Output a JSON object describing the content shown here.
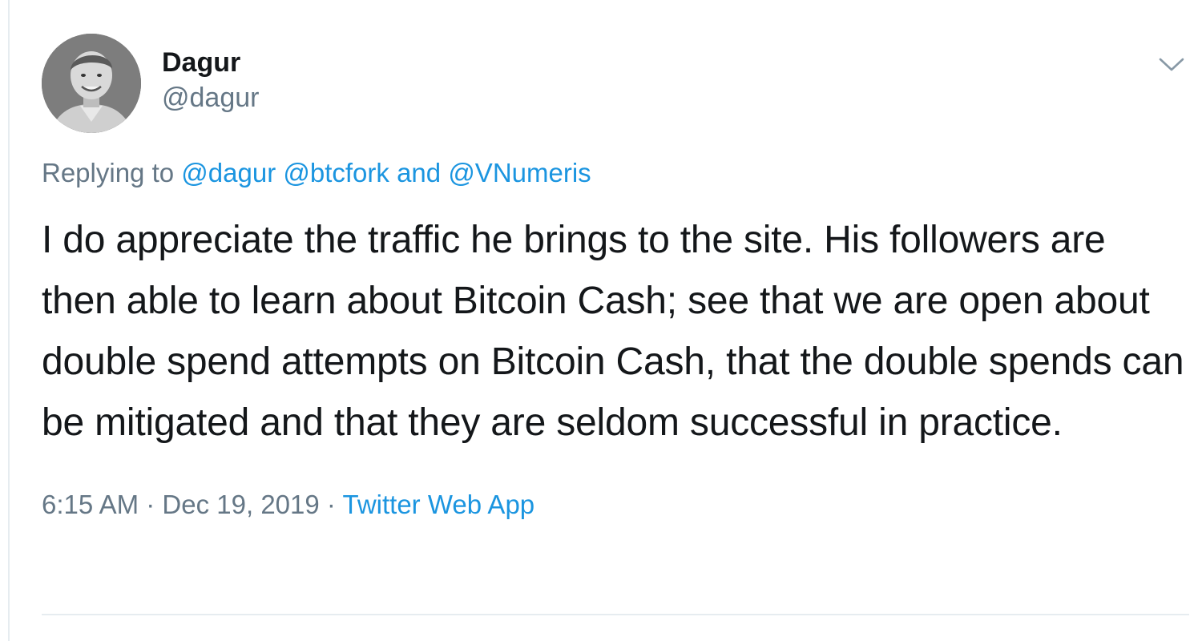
{
  "tweet": {
    "display_name": "Dagur",
    "handle": "@dagur",
    "replying_prefix": "Replying to",
    "reply_mentions": [
      "@dagur",
      "@btcfork"
    ],
    "reply_and": "and",
    "reply_last_mention": "@VNumeris",
    "text": "I do appreciate the traffic he brings to the site. His followers are then able to learn about Bitcoin Cash; see that we are open about double spend attempts on Bitcoin Cash, that the double spends can be mitigated and that they are seldom successful in practice.",
    "time": "6:15 AM",
    "separator": "·",
    "date": "Dec 19, 2019",
    "source": "Twitter Web App"
  },
  "icons": {
    "caret": "chevron-down-icon",
    "avatar": "avatar"
  },
  "colors": {
    "link": "#1b95e0",
    "secondary": "#657786",
    "primary_text": "#14171a",
    "border": "#e6ecf0"
  }
}
